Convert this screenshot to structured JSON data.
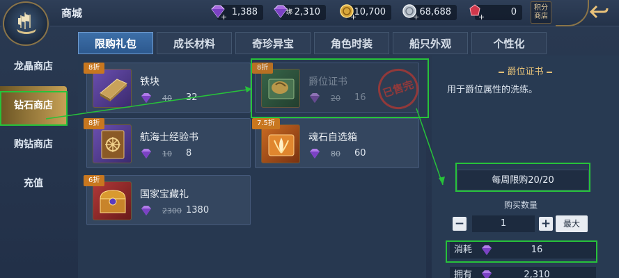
{
  "header": {
    "title": "商城",
    "points_shop": "积分商店",
    "back_icon": "back-arrow-icon"
  },
  "currencies": [
    {
      "icon": "purple-gem-plus-icon",
      "value": "1,388"
    },
    {
      "icon": "purple-gem-bound-icon",
      "value": "2,310",
      "tag": "绑"
    },
    {
      "icon": "gold-coin-plus-icon",
      "value": "10,700"
    },
    {
      "icon": "silver-coin-plus-icon",
      "value": "68,688"
    },
    {
      "icon": "red-gem-plus-icon",
      "value": "0"
    }
  ],
  "sidebar": {
    "items": [
      {
        "label": "龙晶商店"
      },
      {
        "label": "钻石商店",
        "active": true
      },
      {
        "label": "购钻商店"
      },
      {
        "label": "充值"
      }
    ]
  },
  "tabs": [
    {
      "label": "限购礼包",
      "active": true
    },
    {
      "label": "成长材料"
    },
    {
      "label": "奇珍异宝"
    },
    {
      "label": "角色时装"
    },
    {
      "label": "船只外观"
    },
    {
      "label": "个性化"
    }
  ],
  "items": [
    {
      "name": "铁块",
      "discount": "8折",
      "old_price": "40",
      "price": "32",
      "sold_out": false
    },
    {
      "name": "爵位证书",
      "discount": "8折",
      "old_price": "20",
      "price": "16",
      "sold_out": true,
      "stamp": "已售完"
    },
    {
      "name": "航海士经验书",
      "discount": "8折",
      "old_price": "10",
      "price": "8",
      "sold_out": false
    },
    {
      "name": "魂石自选箱",
      "discount": "7.5折",
      "old_price": "80",
      "price": "60",
      "sold_out": false
    },
    {
      "name": "国家宝藏礼",
      "discount": "6折",
      "old_price": "2300",
      "price": "1380",
      "sold_out": false
    }
  ],
  "detail": {
    "title": "爵位证书",
    "description": "用于爵位属性的洗练。",
    "weekly_limit": "每周限购20/20",
    "qty_label": "购买数量",
    "quantity": "1",
    "max_label": "最大",
    "cost_label": "消耗",
    "cost": "16",
    "own_label": "拥有",
    "own": "2,310"
  },
  "colors": {
    "accent": "#c7a155",
    "tab_active": "#3d6fa8",
    "annotation": "#27c23a",
    "stamp": "#b23a34"
  }
}
